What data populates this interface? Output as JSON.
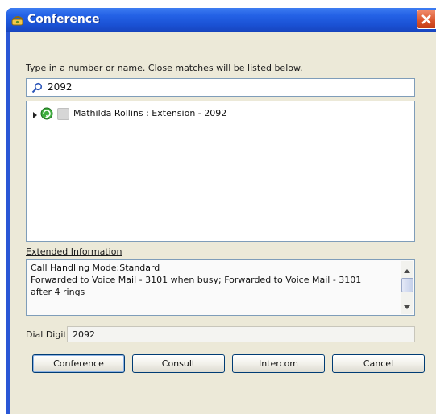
{
  "window": {
    "title": "Conference",
    "title_icon": "conference-phone-icon",
    "close_icon": "close-icon"
  },
  "search": {
    "instruction": "Type in a number or name.  Close matches will be listed below.",
    "value": "2092",
    "icon": "search-icon"
  },
  "results": [
    {
      "text": "Mathilda Rollins : Extension - 2092",
      "status_icon": "available-status-icon"
    }
  ],
  "extended_info": {
    "label": "Extended Information",
    "lines": [
      "Call Handling Mode:Standard",
      "Forwarded to Voice Mail - 3101 when busy; Forwarded to Voice Mail - 3101",
      "after 4 rings"
    ]
  },
  "dial_digits": {
    "label": "Dial Digits",
    "value": "2092"
  },
  "buttons": {
    "conference": "Conference",
    "consult": "Consult",
    "intercom": "Intercom",
    "cancel": "Cancel"
  },
  "colors": {
    "titlebar": "#2462e6",
    "dialog_face": "#ece9d8",
    "field_border": "#7f9db9"
  }
}
